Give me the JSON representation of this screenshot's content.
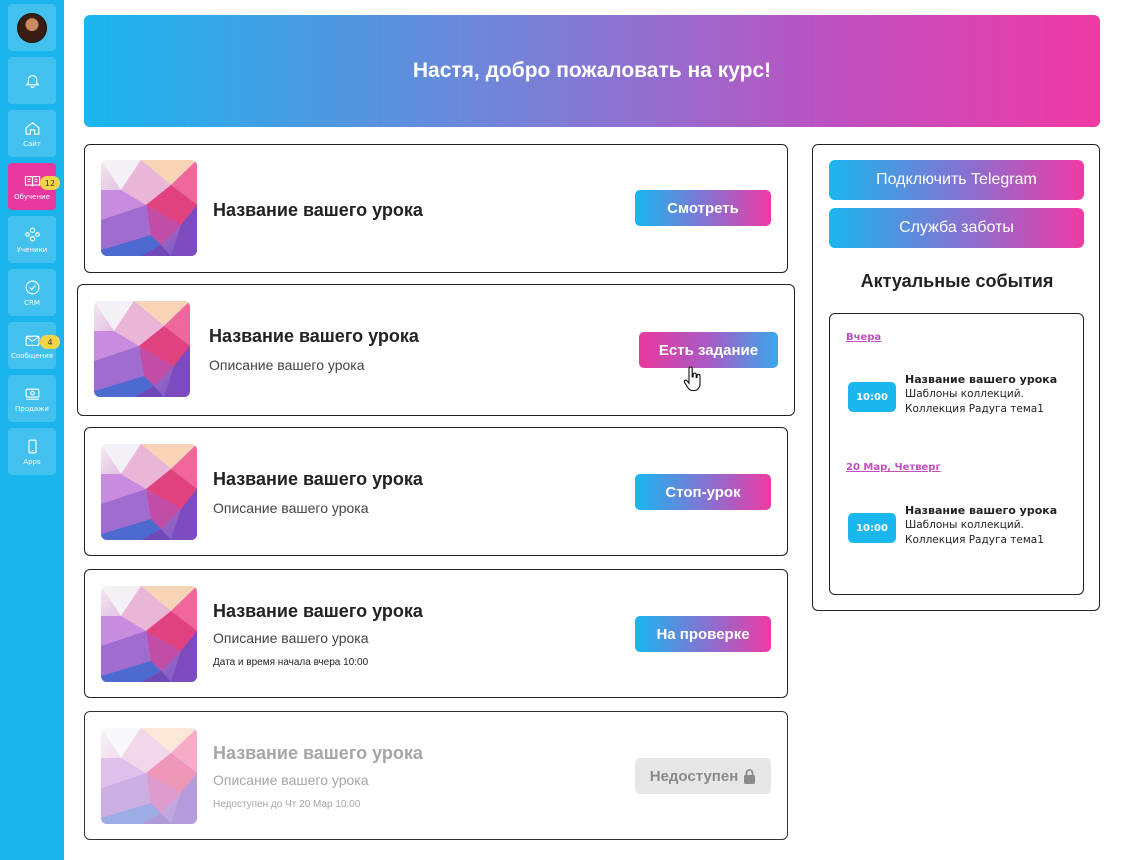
{
  "sidebar": {
    "items": [
      {
        "label": "",
        "icon": "avatar"
      },
      {
        "label": "",
        "icon": "bell-icon"
      },
      {
        "label": "Сайт",
        "icon": "home-icon"
      },
      {
        "label": "Обучение",
        "icon": "book-icon",
        "badge": "12"
      },
      {
        "label": "Ученики",
        "icon": "users-icon"
      },
      {
        "label": "CRM",
        "icon": "check-circle-icon"
      },
      {
        "label": "Сообщения",
        "icon": "mail-icon",
        "badge": "4"
      },
      {
        "label": "Продажи",
        "icon": "cash-icon"
      },
      {
        "label": "Apps",
        "icon": "phone-icon"
      }
    ]
  },
  "banner": {
    "title": "Настя, добро пожаловать на курс!"
  },
  "lessons": [
    {
      "title": "Название вашего урока",
      "description": "",
      "meta": "",
      "button": "Смотреть"
    },
    {
      "title": "Название вашего урока",
      "description": "Описание вашего урока",
      "meta": "",
      "button": "Есть задание"
    },
    {
      "title": "Название вашего урока",
      "description": "Описание вашего урока",
      "meta": "",
      "button": "Стоп-урок"
    },
    {
      "title": "Название вашего урока",
      "description": "Описание вашего урока",
      "meta": "Дата и время начала вчера 10:00",
      "button": "На проверке"
    },
    {
      "title": "Название вашего урока",
      "description": "Описание вашего урока",
      "meta": "Недоступен до Чт 20 Мар 10:00",
      "button": "Недоступен"
    }
  ],
  "panel": {
    "telegram_button": "Подключить Telegram",
    "support_button": "Служба заботы",
    "events_title": "Актуальные события",
    "events": [
      {
        "date": "Вчера",
        "time": "10:00",
        "title": "Название вашего урока",
        "description": "Шаблоны коллекций. Коллекция Радуга тема1"
      },
      {
        "date": "20 Мар, Четверг",
        "time": "10:00",
        "title": "Название вашего урока",
        "description": "Шаблоны коллекций. Коллекция Радуга тема1"
      }
    ]
  },
  "colors": {
    "sidebar": "#19b4ec",
    "accent_pink": "#ef3aa4",
    "accent_blue": "#1ab6ee",
    "badge": "#f5d547"
  }
}
